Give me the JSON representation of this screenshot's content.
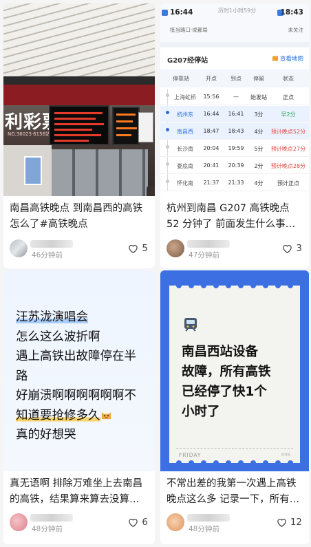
{
  "feed": [
    {
      "title": "南昌高铁晚点 到南昌西的高铁怎么了#高铁晚点",
      "time": "46分钟前",
      "likes": "5",
      "cover": {
        "lottery_sign": "利彩票",
        "lottery_sub": "NO.36023·6156站点"
      }
    },
    {
      "title": "杭州到南昌 G207 高铁晚点 52 分钟了 前面发生什么事了…",
      "time": "47分钟前",
      "likes": "3",
      "timetable": {
        "depart_time": "16:44",
        "arrive_time": "18:43",
        "duration": "历时1小时59分",
        "route_note": "抵当路口·成都局",
        "follow": "未关注",
        "heading": "G207经停站",
        "map_link": "查看地图",
        "columns": [
          "停靠站",
          "开点",
          "到点",
          "停留",
          "状态"
        ],
        "rows": [
          {
            "station": "上海虹桥",
            "depart": "15:56",
            "arrive": "—",
            "stay": "始发站",
            "status": "正点",
            "status_color": "#333333"
          },
          {
            "station": "杭州东",
            "depart": "16:44",
            "arrive": "16:41",
            "stay": "3分",
            "status": "早2分",
            "status_color": "#2a9d4a"
          },
          {
            "station": "南昌西",
            "depart": "18:47",
            "arrive": "18:43",
            "stay": "4分",
            "status": "预计晚点52分",
            "status_color": "#e2463c"
          },
          {
            "station": "长沙南",
            "depart": "20:04",
            "arrive": "19:59",
            "stay": "5分",
            "status": "预计晚点27分",
            "status_color": "#e2463c"
          },
          {
            "station": "娄底南",
            "depart": "20:41",
            "arrive": "20:39",
            "stay": "2分",
            "status": "预计晚点28分",
            "status_color": "#e2463c"
          },
          {
            "station": "怀化南",
            "depart": "21:37",
            "arrive": "21:33",
            "stay": "4分",
            "status": "预计正点",
            "status_color": "#333333"
          }
        ]
      }
    },
    {
      "title": "真无语啊 排除万难坐上去南昌的高铁，结果算来算去没算…",
      "time": "48分钟前",
      "likes": "6",
      "cover_lines": [
        "汪苏泷演唱会",
        "怎么这么波折啊",
        "遇上高铁出故障停在半",
        "路",
        "好崩溃啊啊啊啊啊啊不",
        "知道要抢修多久",
        "真的好想哭"
      ],
      "cover_emoji": "cat-face-icon"
    },
    {
      "title": "不常出差的我第一次遇上高铁晚点这么多 记录一下，所有…",
      "time": "48分钟前",
      "likes": "12",
      "cover_lines": [
        "南昌西站设备",
        "故障，所有高铁",
        "已经停了快1个",
        "小时了"
      ],
      "cover_footer": "FRIDAY",
      "cover_code": "898"
    }
  ],
  "colors": {
    "ticket_blue": "#3b6fe2",
    "delay_red": "#e2463c",
    "early_green": "#2a9d4a",
    "link_blue": "#2b6fdc"
  }
}
